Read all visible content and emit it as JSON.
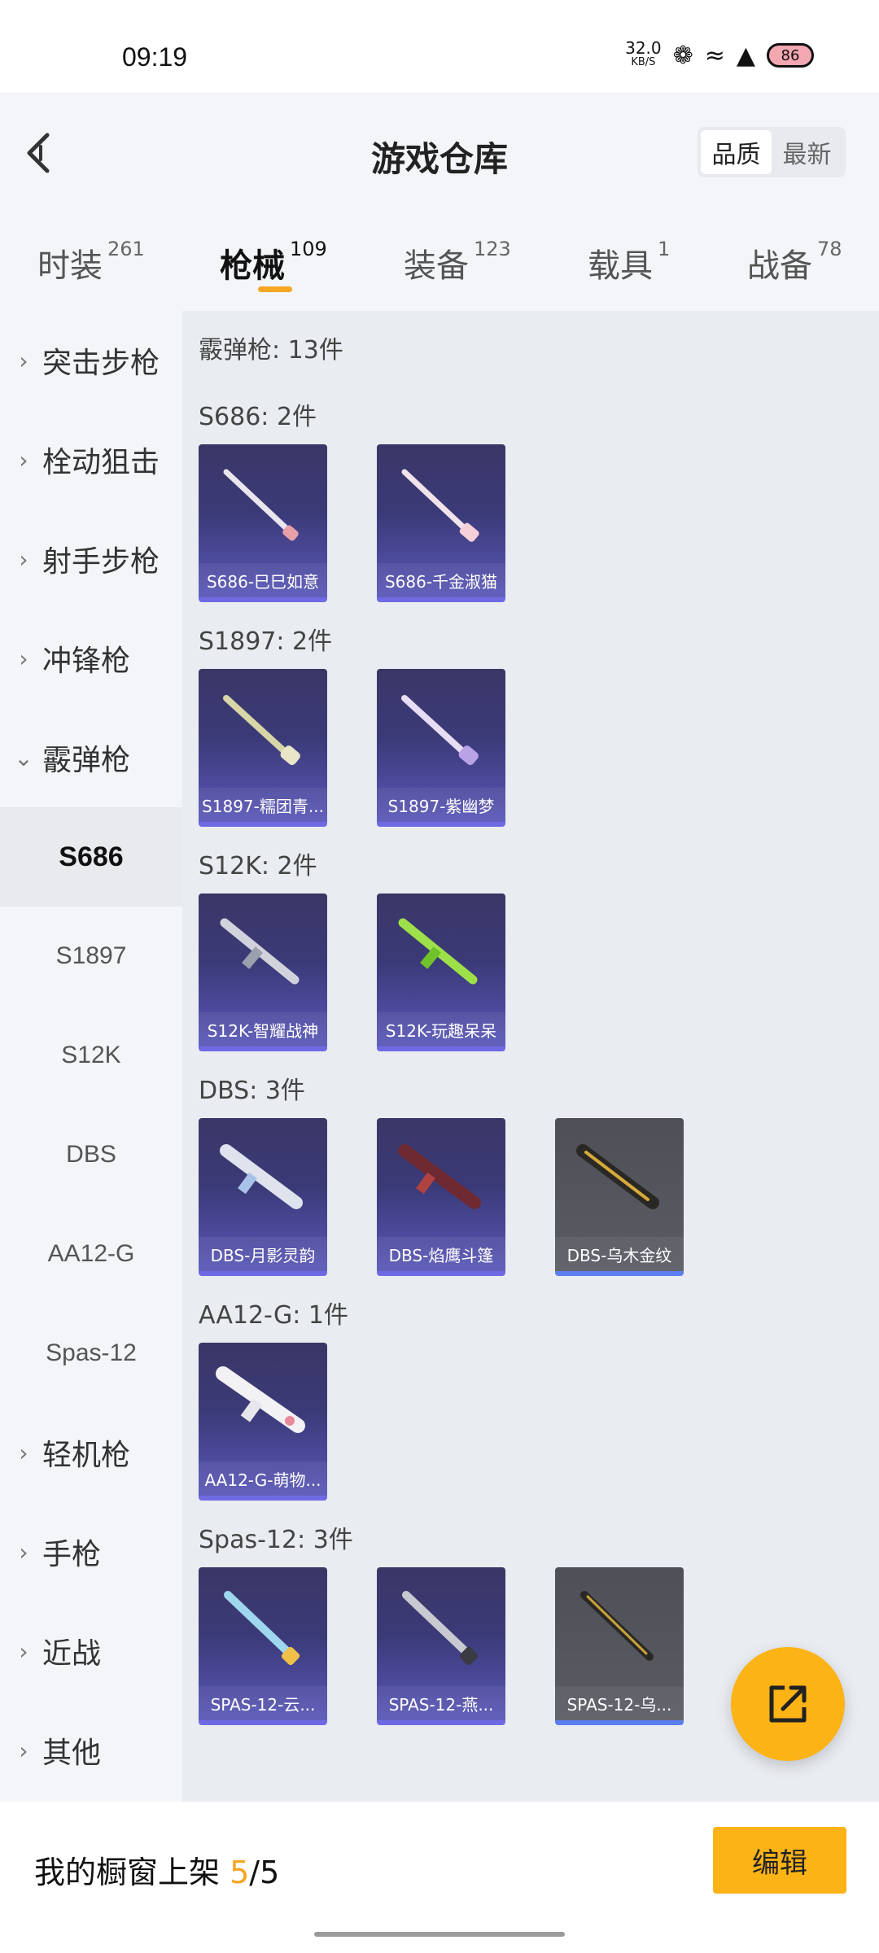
{
  "status_bar": {
    "time": "09:19",
    "net_speed": "32.0",
    "net_unit": "KB/S",
    "battery": "86"
  },
  "header": {
    "title": "游戏仓库",
    "sort_options": [
      "品质",
      "最新"
    ],
    "sort_selected": "品质"
  },
  "tabs": [
    {
      "label": "时装",
      "count": "261"
    },
    {
      "label": "枪械",
      "count": "109"
    },
    {
      "label": "装备",
      "count": "123"
    },
    {
      "label": "载具",
      "count": "1"
    },
    {
      "label": "战备",
      "count": "78"
    }
  ],
  "active_tab": "枪械",
  "sidebar": {
    "categories_top": [
      "突击步枪",
      "栓动狙击",
      "射手步枪",
      "冲锋枪"
    ],
    "expanded_category": "霰弹枪",
    "subcategories": [
      "S686",
      "S1897",
      "S12K",
      "DBS",
      "AA12-G",
      "Spas-12"
    ],
    "selected_sub": "S686",
    "categories_bottom": [
      "轻机枪",
      "手枪",
      "近战",
      "其他"
    ]
  },
  "content": {
    "summary": "霰弹枪: 13件",
    "groups": [
      {
        "label": "S686: 2件",
        "items": [
          "S686-巳巳如意",
          "S686-千金淑猫"
        ]
      },
      {
        "label": "S1897: 2件",
        "items": [
          "S1897-糯团青...",
          "S1897-紫幽梦"
        ]
      },
      {
        "label": "S12K: 2件",
        "items": [
          "S12K-智耀战神",
          "S12K-玩趣呆呆"
        ]
      },
      {
        "label": "DBS: 3件",
        "items": [
          "DBS-月影灵韵",
          "DBS-焰鹰斗篷",
          "DBS-乌木金纹"
        ]
      },
      {
        "label": "AA12-G: 1件",
        "items": [
          "AA12-G-萌物..."
        ]
      },
      {
        "label": "Spas-12: 3件",
        "items": [
          "SPAS-12-云...",
          "SPAS-12-燕...",
          "SPAS-12-乌..."
        ]
      }
    ]
  },
  "bottom_bar": {
    "showcase_prefix": "我的橱窗上架 ",
    "showcase_current": "5",
    "showcase_total": "/5",
    "edit_label": "编辑"
  },
  "colors": {
    "accent": "#fbb316",
    "card_purple": "#3b3a78",
    "card_grey": "#55565e"
  }
}
